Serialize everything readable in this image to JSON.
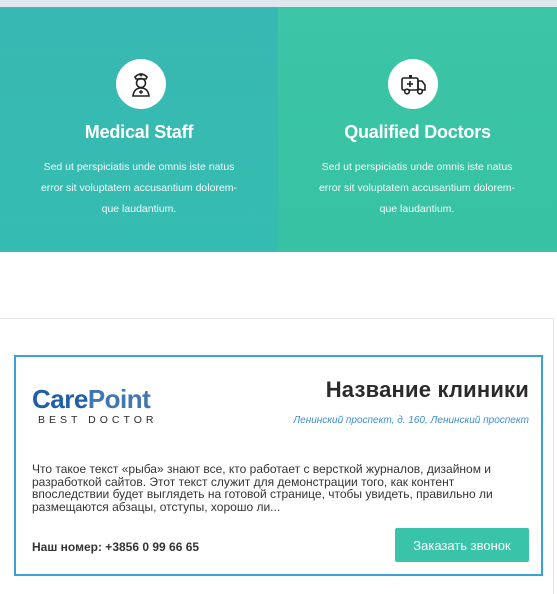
{
  "features": [
    {
      "icon": "nurse-icon",
      "title": "Medical Staff",
      "text": "Sed ut perspiciatis unde omnis iste natus error sit voluptatem accusantium dolorem-que laudantium."
    },
    {
      "icon": "ambulance-icon",
      "title": "Qualified Doctors",
      "text": "Sed ut perspiciatis unde omnis iste natus error sit voluptatem accusantium dolorem-que laudantium."
    }
  ],
  "card": {
    "logo_care": "Care",
    "logo_point": "Point",
    "logo_sub": "BEST DOCTOR",
    "clinic_name": "Название клиники",
    "address": "Ленинский проспект, д. 160, Ленинский проспект",
    "description": "Что такое текст «рыба» знают все, кто работает с версткой журналов, дизайном и разработкой сайтов. Этот текст служит для демонстрации того, как контент впоследствии будет выглядеть на готовой странице, чтобы увидеть, правильно ли размещаются абзацы, отступы, хорошо ли...",
    "phone_label": "Наш номер: +3856 0 99 66 65",
    "call_button": "Заказать звонок"
  },
  "colors": {
    "panel_left": "#38b8b2",
    "panel_right": "#3cc5a6",
    "card_border": "#3aa3d6",
    "button": "#39c3a8",
    "logo_blue": "#1f5fa8"
  }
}
